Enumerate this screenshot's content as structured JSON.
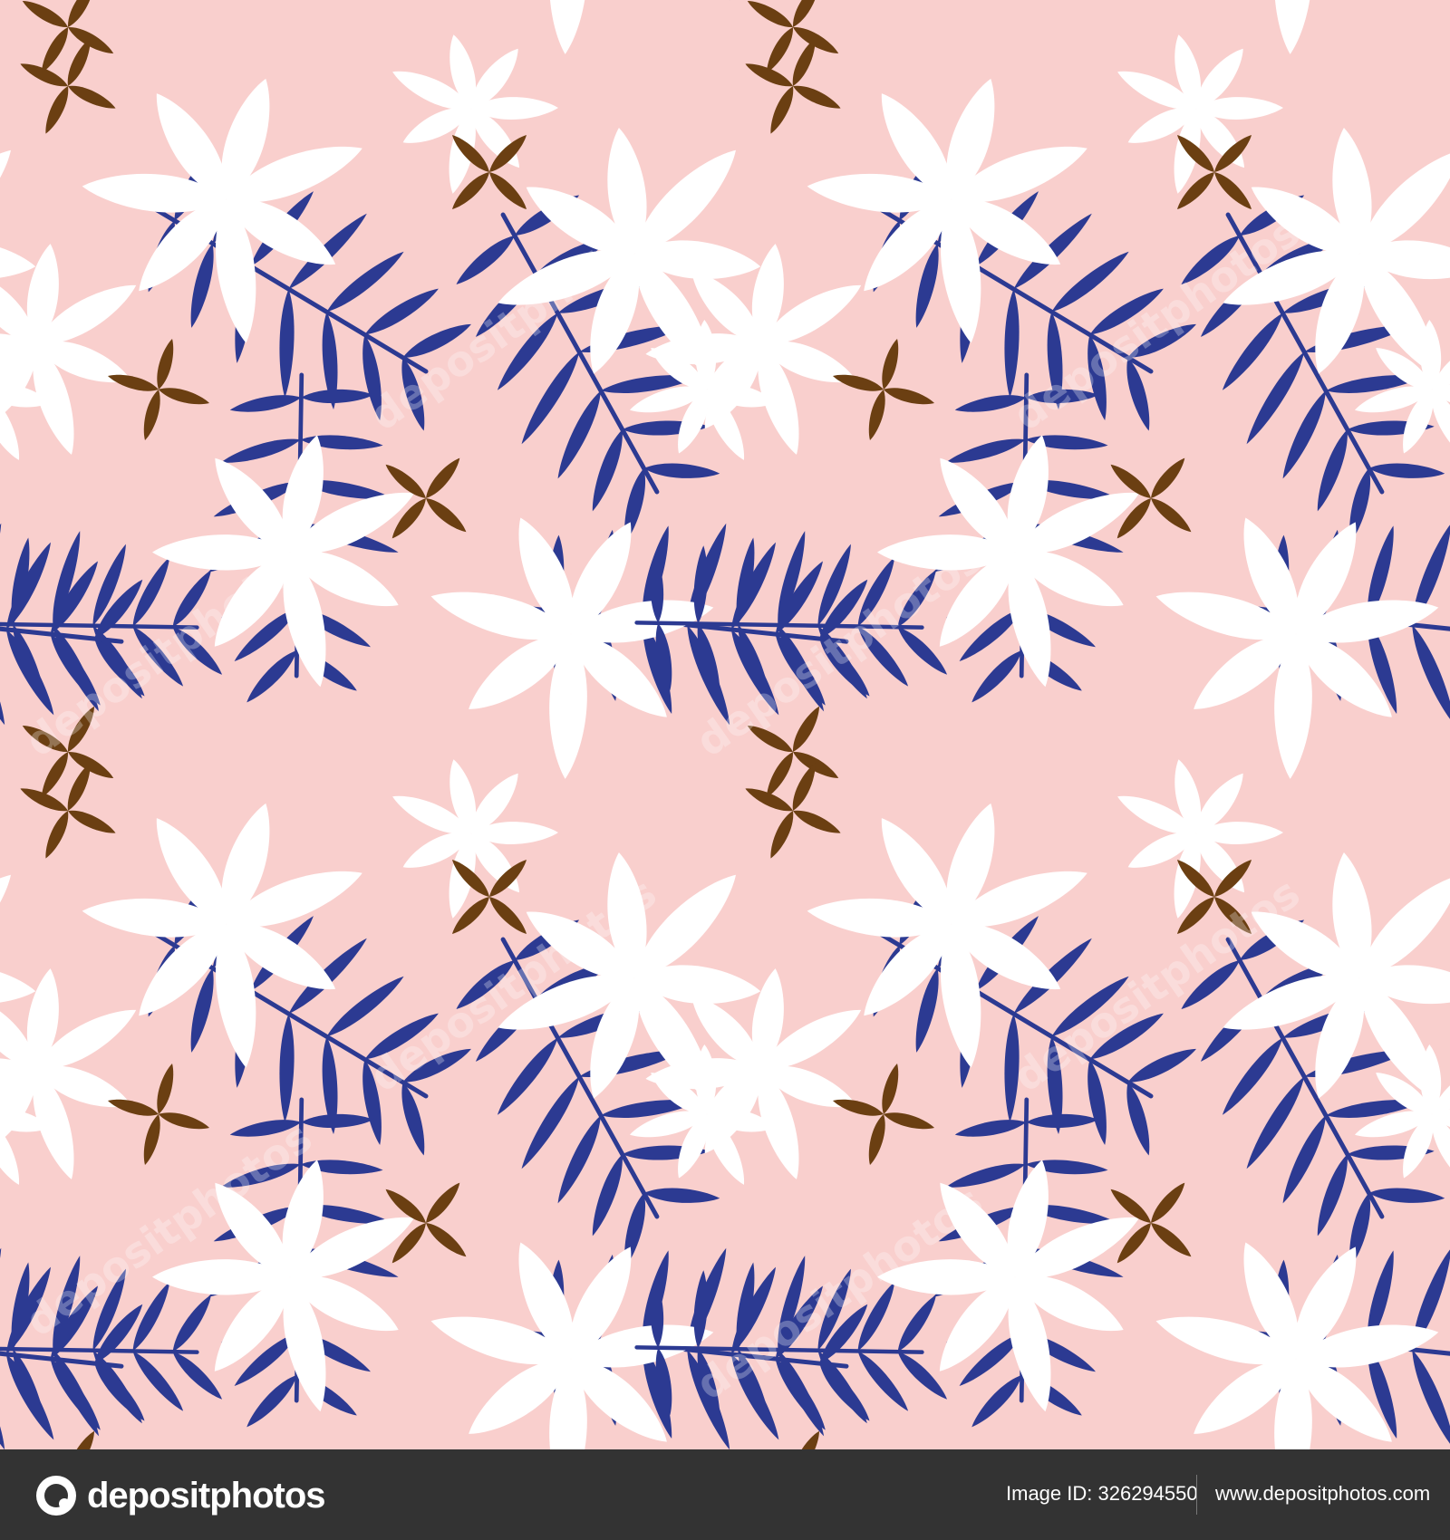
{
  "pattern": {
    "background_color": "#f9cfcd",
    "leaf_blue": "#2c3a92",
    "leaf_white": "#ffffff",
    "cross_brown": "#6b3f12",
    "watermark_text": "depositphotos"
  },
  "footer": {
    "background_color": "#333333",
    "brand_name": "depositphotos",
    "image_id": "Image ID: 326294550",
    "url": "www.depositphotos.com"
  }
}
